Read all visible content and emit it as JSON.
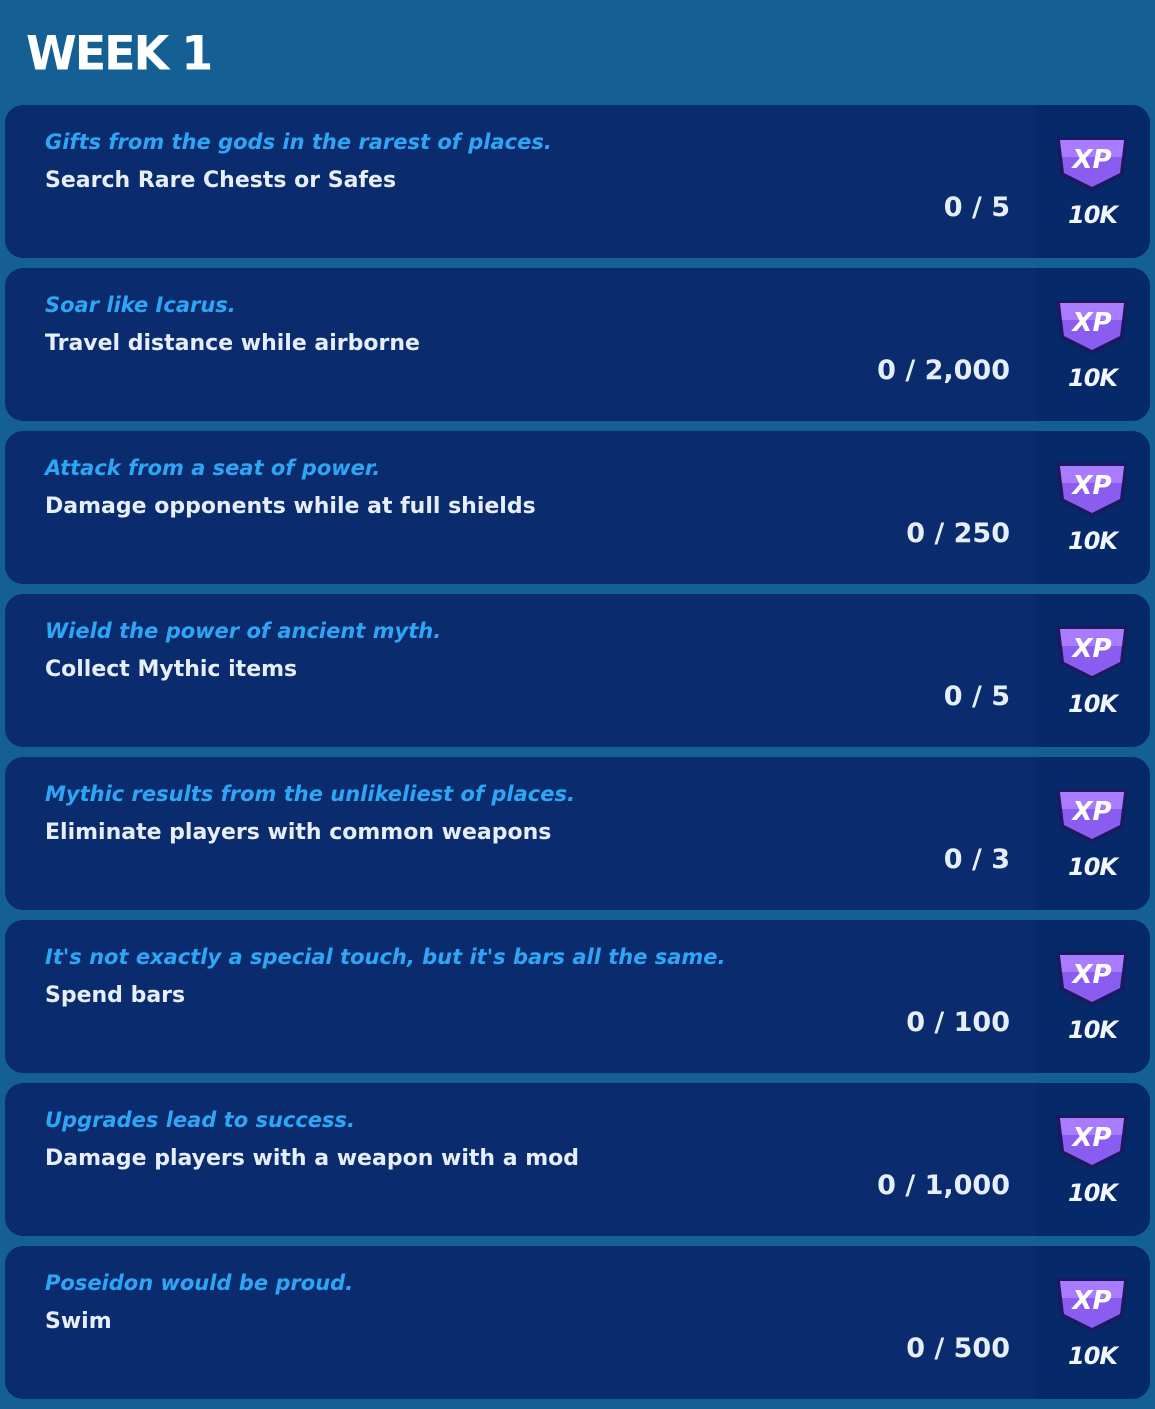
{
  "header": {
    "title": "WEEK 1"
  },
  "colors": {
    "background": "#145f94",
    "card": "#0a2c6e",
    "reward_panel": "#06296a",
    "flavor_text": "#2ea6f5",
    "primary_text": "#e6eefa",
    "xp_badge": "#7b4fe0"
  },
  "quests": [
    {
      "flavor": "Gifts from the gods in the rarest of places.",
      "description": "Search Rare Chests or Safes",
      "progress": "0 / 5",
      "reward_icon": "xp-badge-icon",
      "reward_icon_text": "XP",
      "reward": "10K"
    },
    {
      "flavor": "Soar like Icarus.",
      "description": "Travel distance while airborne",
      "progress": "0 / 2,000",
      "reward_icon": "xp-badge-icon",
      "reward_icon_text": "XP",
      "reward": "10K"
    },
    {
      "flavor": "Attack from a seat of power.",
      "description": "Damage opponents while at full shields",
      "progress": "0 / 250",
      "reward_icon": "xp-badge-icon",
      "reward_icon_text": "XP",
      "reward": "10K"
    },
    {
      "flavor": "Wield the power of ancient myth.",
      "description": "Collect Mythic items",
      "progress": "0 / 5",
      "reward_icon": "xp-badge-icon",
      "reward_icon_text": "XP",
      "reward": "10K"
    },
    {
      "flavor": "Mythic results from the unlikeliest of places.",
      "description": "Eliminate players with common weapons",
      "progress": "0 / 3",
      "reward_icon": "xp-badge-icon",
      "reward_icon_text": "XP",
      "reward": "10K"
    },
    {
      "flavor": "It's not exactly a special touch, but it's bars all the same.",
      "description": "Spend bars",
      "progress": "0 / 100",
      "reward_icon": "xp-badge-icon",
      "reward_icon_text": "XP",
      "reward": "10K"
    },
    {
      "flavor": "Upgrades lead to success.",
      "description": "Damage players with a weapon with a mod",
      "progress": "0 / 1,000",
      "reward_icon": "xp-badge-icon",
      "reward_icon_text": "XP",
      "reward": "10K"
    },
    {
      "flavor": "Poseidon would be proud.",
      "description": "Swim",
      "progress": "0 / 500",
      "reward_icon": "xp-badge-icon",
      "reward_icon_text": "XP",
      "reward": "10K"
    }
  ]
}
